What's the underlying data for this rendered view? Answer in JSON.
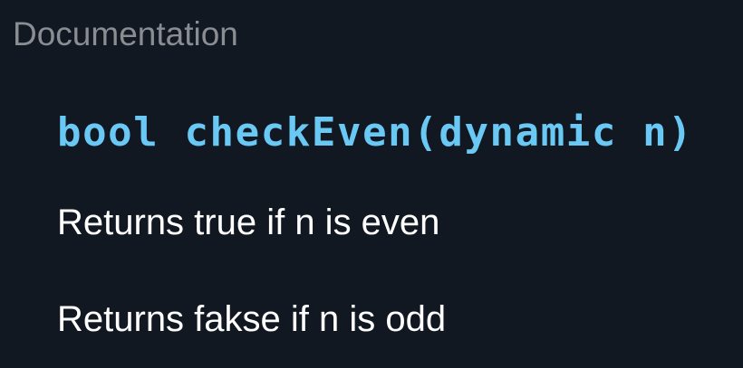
{
  "panel": {
    "title": "Documentation"
  },
  "function": {
    "signature": "bool checkEven(dynamic n)"
  },
  "description": {
    "lines": [
      "Returns true if n is even",
      "Returns fakse if n is odd"
    ]
  },
  "colors": {
    "background": "#111822",
    "title": "#8a8d91",
    "signature": "#6ac8f4",
    "text": "#ffffff"
  }
}
